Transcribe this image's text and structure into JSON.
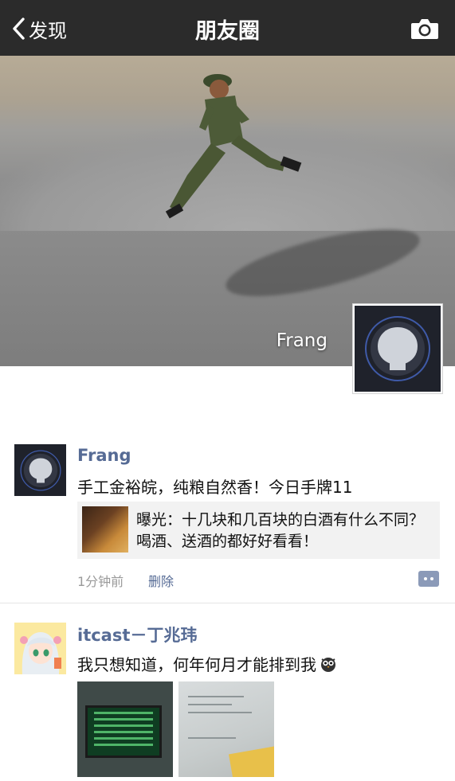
{
  "nav": {
    "back_label": "发现",
    "title": "朋友圈",
    "back_icon": "chevron-left-icon",
    "camera_icon": "camera-icon"
  },
  "cover": {
    "user_name": "Frang",
    "avatar_icon": "github-icon"
  },
  "posts": [
    {
      "author": "Frang",
      "text": "手工金裕皖，纯粮自然香！今日手牌11",
      "share": {
        "text": "曝光：十几块和几百块的白酒有什么不同？喝酒、送酒的都好好看看！"
      },
      "time": "1分钟前",
      "delete_label": "删除"
    },
    {
      "author": "itcast－丁兆玮",
      "text": "我只想知道，何年何月才能排到我",
      "emoji_icon": "owl-emoji-icon",
      "photos": [
        "queue-display-photo",
        "ticket-photo"
      ]
    }
  ],
  "colors": {
    "nav_bg": "#2b2b2b",
    "name_link": "#566b95",
    "meta_gray": "#9a9a9a",
    "share_bg": "#f2f2f2"
  }
}
